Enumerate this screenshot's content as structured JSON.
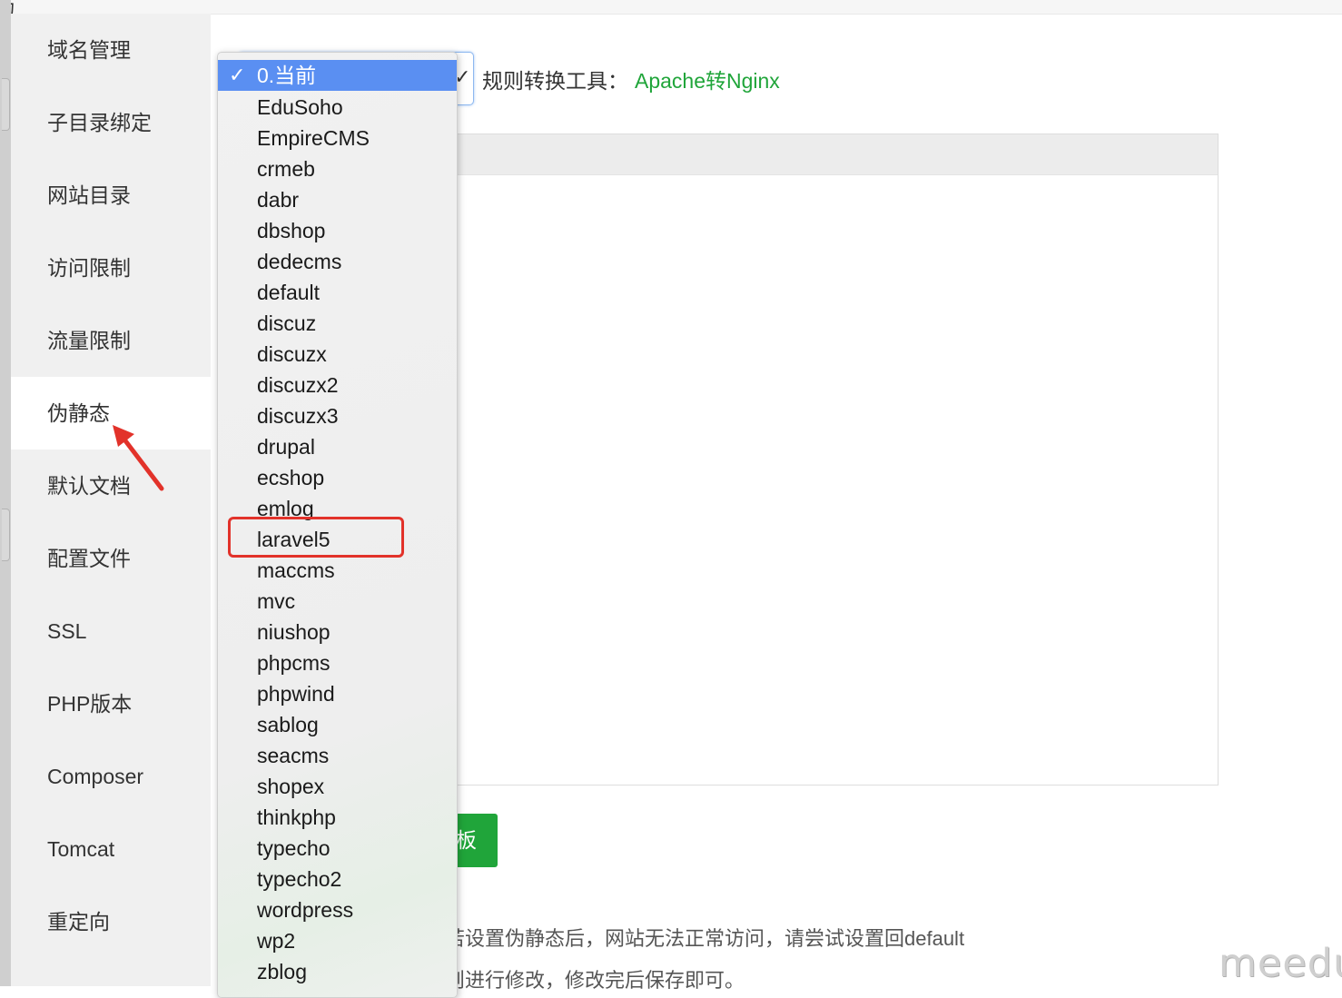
{
  "top_fragment": "功",
  "sidebar": {
    "items": [
      {
        "label": "域名管理"
      },
      {
        "label": "子目录绑定"
      },
      {
        "label": "网站目录"
      },
      {
        "label": "访问限制"
      },
      {
        "label": "流量限制"
      },
      {
        "label": "伪静态",
        "active": true
      },
      {
        "label": "默认文档"
      },
      {
        "label": "配置文件"
      },
      {
        "label": "SSL"
      },
      {
        "label": "PHP版本"
      },
      {
        "label": "Composer"
      },
      {
        "label": "Tomcat"
      },
      {
        "label": "重定向"
      }
    ]
  },
  "toolbar": {
    "select_check": "✓",
    "tool_label": "规则转换工具：",
    "tool_link": "Apache转Nginx"
  },
  "rewrite_dropdown": {
    "selected_check": "✓",
    "options": [
      "0.当前",
      "EduSoho",
      "EmpireCMS",
      "crmeb",
      "dabr",
      "dbshop",
      "dedecms",
      "default",
      "discuz",
      "discuzx",
      "discuzx2",
      "discuzx3",
      "drupal",
      "ecshop",
      "emlog",
      "laravel5",
      "maccms",
      "mvc",
      "niushop",
      "phpcms",
      "phpwind",
      "sablog",
      "seacms",
      "shopex",
      "thinkphp",
      "typecho",
      "typecho2",
      "wordpress",
      "wp2",
      "zblog"
    ],
    "selected_option": "0.当前",
    "highlighted_option": "laravel5"
  },
  "template_button_fragment": "板",
  "tips": {
    "line1": "若设置伪静态后，网站无法正常访问，请尝试设置回default",
    "line2": "则进行修改，修改完后保存即可。"
  },
  "watermark": "meedu",
  "colors": {
    "accent_green": "#20a53a",
    "selection_blue": "#5a8ff2",
    "annotation_red": "#e2322a"
  }
}
